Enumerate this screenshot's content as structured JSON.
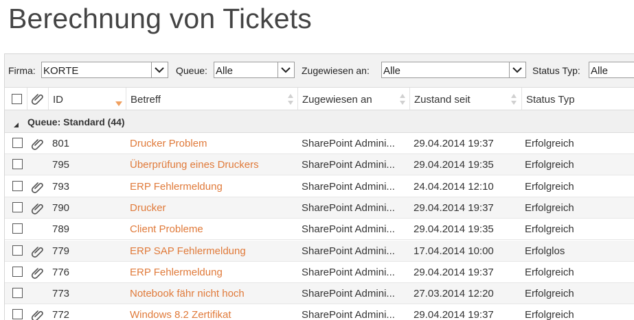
{
  "page_title": "Berechnung von Tickets",
  "filters": {
    "firma_label": "Firma:",
    "firma_value": "KORTE",
    "queue_label": "Queue:",
    "queue_value": "Alle",
    "zugewiesen_label": "Zugewiesen an:",
    "zugewiesen_value": "Alle",
    "statustyp_label": "Status Typ:",
    "statustyp_value": "Alle"
  },
  "columns": {
    "id": "ID",
    "betreff": "Betreff",
    "zugewiesen": "Zugewiesen an",
    "zustand": "Zustand seit",
    "status": "Status Typ"
  },
  "group_label": "Queue: Standard (44)",
  "colors": {
    "link": "#e07a3a",
    "sort_active": "#f0a060"
  },
  "rows": [
    {
      "attachment": true,
      "id": "801",
      "betreff": "Drucker Problem",
      "zugewiesen": "SharePoint Admini...",
      "zustand": "29.04.2014 19:37",
      "status": "Erfolgreich"
    },
    {
      "attachment": false,
      "id": "795",
      "betreff": "Überprüfung eines Druckers",
      "zugewiesen": "SharePoint Admini...",
      "zustand": "29.04.2014 19:35",
      "status": "Erfolgreich"
    },
    {
      "attachment": true,
      "id": "793",
      "betreff": "ERP Fehlermeldung",
      "zugewiesen": "SharePoint Admini...",
      "zustand": "24.04.2014 12:10",
      "status": "Erfolgreich"
    },
    {
      "attachment": true,
      "id": "790",
      "betreff": "Drucker",
      "zugewiesen": "SharePoint Admini...",
      "zustand": "29.04.2014 19:37",
      "status": "Erfolgreich"
    },
    {
      "attachment": false,
      "id": "789",
      "betreff": "Client Probleme",
      "zugewiesen": "SharePoint Admini...",
      "zustand": "29.04.2014 19:35",
      "status": "Erfolgreich"
    },
    {
      "attachment": true,
      "id": "779",
      "betreff": "ERP SAP Fehlermeldung",
      "zugewiesen": "SharePoint Admini...",
      "zustand": "17.04.2014 10:00",
      "status": "Erfolglos"
    },
    {
      "attachment": true,
      "id": "776",
      "betreff": "ERP Fehlermeldung",
      "zugewiesen": "SharePoint Admini...",
      "zustand": "29.04.2014 19:37",
      "status": "Erfolgreich"
    },
    {
      "attachment": false,
      "id": "773",
      "betreff": "Notebook fähr nicht hoch",
      "zugewiesen": "SharePoint Admini...",
      "zustand": "27.03.2014 12:20",
      "status": "Erfolgreich"
    },
    {
      "attachment": true,
      "id": "772",
      "betreff": "Windows 8.2 Zertifikat",
      "zugewiesen": "SharePoint Admini...",
      "zustand": "29.04.2014 19:37",
      "status": "Erfolgreich"
    }
  ]
}
